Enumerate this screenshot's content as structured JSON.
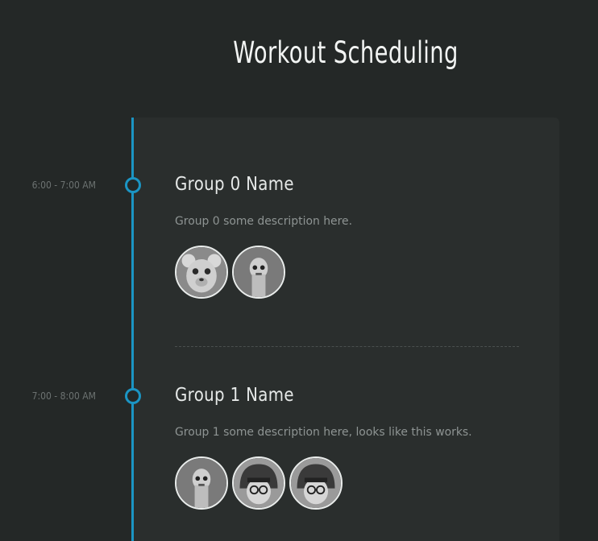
{
  "page": {
    "title": "Workout Scheduling"
  },
  "colors": {
    "background": "#242827",
    "panel": "#2a2e2d",
    "accent": "#1b95c4"
  },
  "groups": [
    {
      "time": "6:00 - 7:00 AM",
      "name": "Group 0 Name",
      "description": "Group 0 some description here.",
      "members": [
        "bear-character-avatar",
        "droid-avatar"
      ]
    },
    {
      "time": "7:00 - 8:00 AM",
      "name": "Group 1 Name",
      "description": "Group 1 some description here, looks like this works.",
      "members": [
        "droid-avatar",
        "helmet-pilot-avatar",
        "helmet-pilot-avatar"
      ]
    }
  ]
}
